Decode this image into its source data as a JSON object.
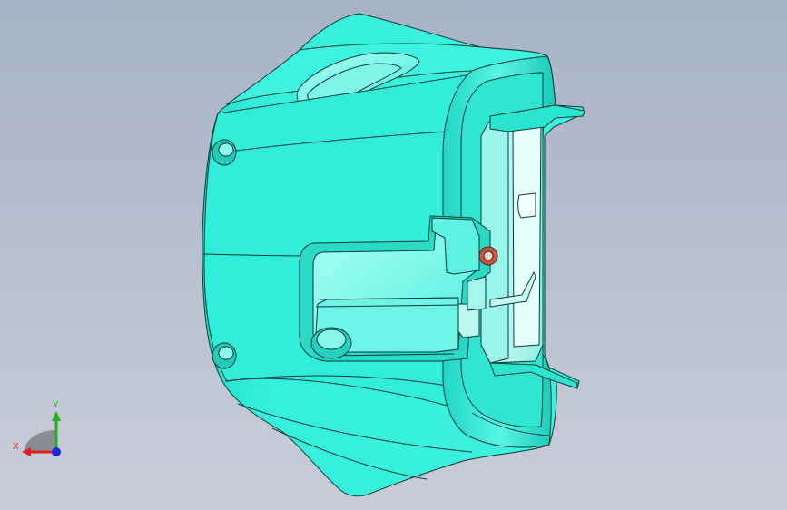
{
  "viewport": {
    "background_top": "#a7b3c6",
    "background_bottom": "#c9cdd8",
    "model_color": "#33f0dc",
    "edge_color": "#0b3b36",
    "hardware_color": "#c5583e"
  },
  "triad": {
    "x_label": "X",
    "y_label": "Y",
    "x_color": "#e02020",
    "y_color": "#20b020",
    "z_color": "#1a2bd6"
  }
}
